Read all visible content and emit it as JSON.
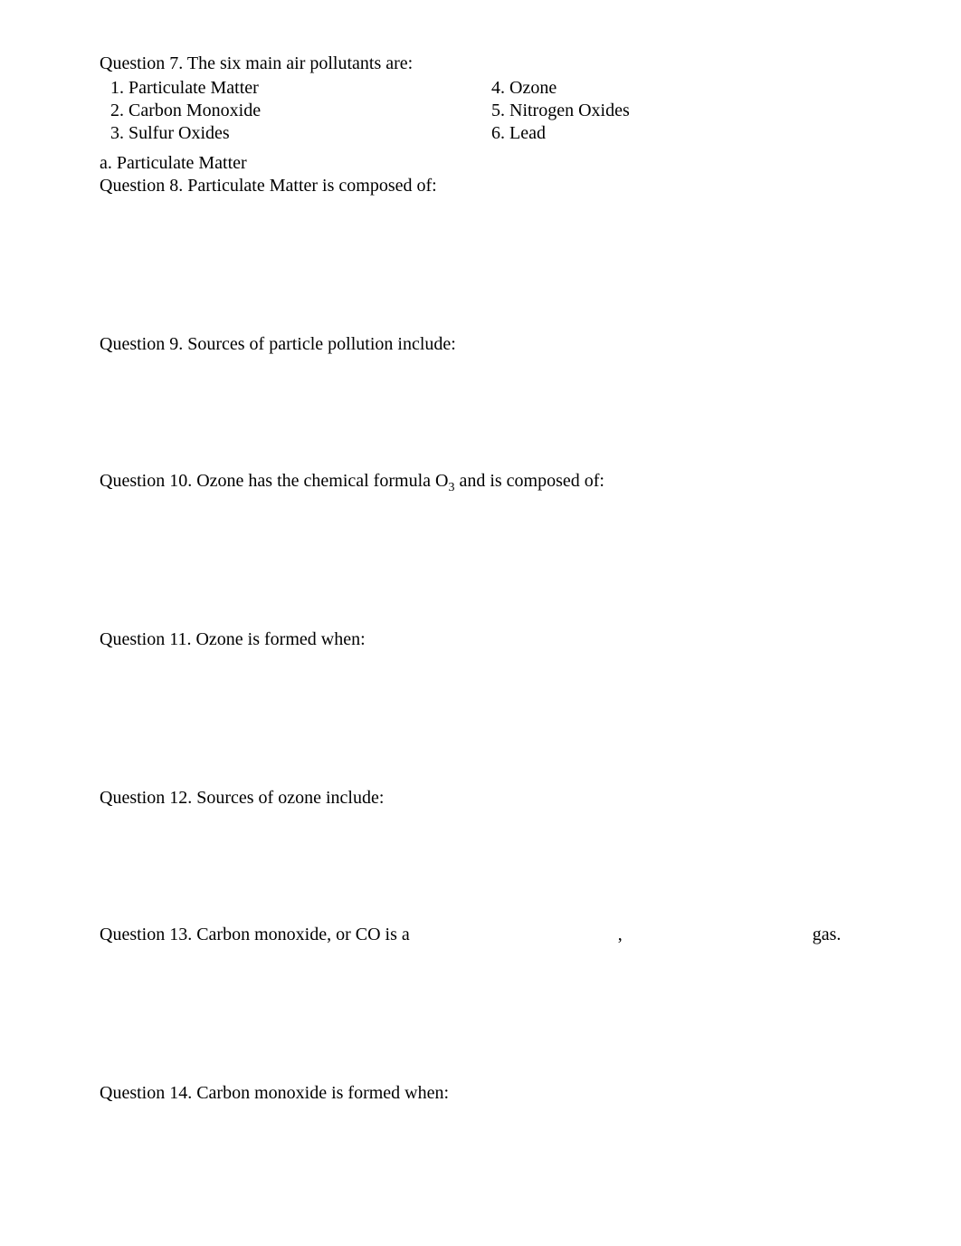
{
  "q7": {
    "text": "Question 7. The six main air pollutants are:",
    "left": [
      "1. Particulate Matter",
      "2. Carbon Monoxide",
      "3. Sulfur Oxides"
    ],
    "right": [
      "4. Ozone",
      "5. Nitrogen Oxides",
      "6. Lead"
    ]
  },
  "q7_sub": "a. Particulate Matter",
  "q8": "Question 8. Particulate Matter is composed of:",
  "q9": "Question 9. Sources of particle pollution include:",
  "q10_pre": "Question 10. Ozone has the chemical formula O",
  "q10_sub": "3",
  "q10_post": " and is composed of:",
  "q11": "Question 11. Ozone is formed when:",
  "q12": "Question 12. Sources of ozone include:",
  "q13": "Question 13. Carbon monoxide, or CO is a                                              ,                                          gas.",
  "q14": "Question 14. Carbon monoxide is formed when:"
}
